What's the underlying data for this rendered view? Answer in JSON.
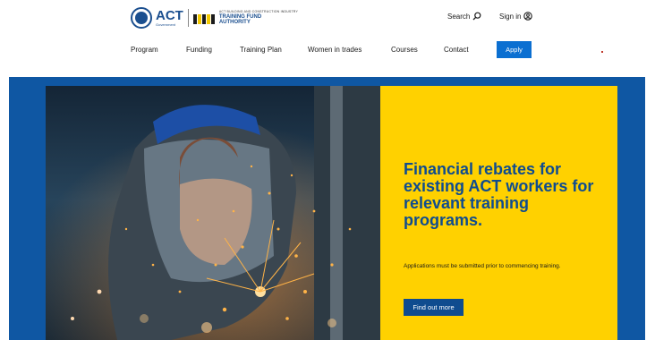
{
  "logo": {
    "act_name": "ACT",
    "act_sub": "Government",
    "tfa_tagline": "ACT BUILDING AND CONSTRUCTION INDUSTRY",
    "tfa_line1": "TRAINING FUND",
    "tfa_line2": "AUTHORITY"
  },
  "utility": {
    "search_label": "Search",
    "signin_label": "Sign in"
  },
  "nav": {
    "items": [
      "Program",
      "Funding",
      "Training Plan",
      "Women in trades",
      "Courses",
      "Contact"
    ],
    "apply_label": "Apply"
  },
  "hero": {
    "headline": "Financial rebates for existing ACT workers for relevant training programs.",
    "subtext": "Applications must be submitted prior to commencing training.",
    "cta_label": "Find out more"
  },
  "colors": {
    "brand_blue": "#0f57a3",
    "apply_blue": "#0b6fd1",
    "panel_yellow": "#ffd100",
    "headline_blue": "#0f4c8f"
  }
}
